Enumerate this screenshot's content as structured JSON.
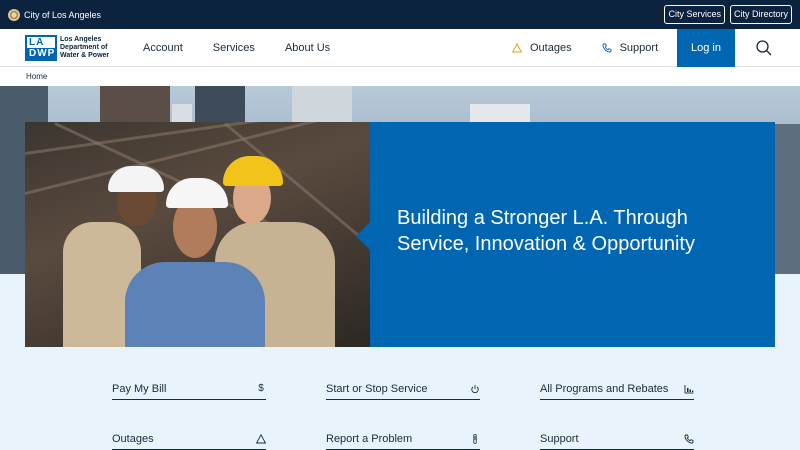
{
  "topbar": {
    "city_label": "City of Los Angeles",
    "city_services": "City Services",
    "city_directory": "City Directory"
  },
  "logo": {
    "mark_top": "LA",
    "mark_bottom": "DWP",
    "text": "Los Angeles Department of Water & Power"
  },
  "nav": {
    "items": [
      "Account",
      "Services",
      "About Us"
    ],
    "outages": "Outages",
    "support": "Support",
    "login": "Log in"
  },
  "breadcrumb": {
    "home": "Home"
  },
  "hero": {
    "title": "Building a Stronger L.A. Through Service, Innovation & Opportunity"
  },
  "quick_links": [
    {
      "label": "Pay My Bill",
      "icon": "dollar-icon"
    },
    {
      "label": "Start or Stop Service",
      "icon": "power-icon"
    },
    {
      "label": "All Programs and Rebates",
      "icon": "bar-chart-icon"
    },
    {
      "label": "Outages",
      "icon": "warning-icon"
    },
    {
      "label": "Report a Problem",
      "icon": "exclamation-icon"
    },
    {
      "label": "Support",
      "icon": "phone-icon"
    }
  ],
  "colors": {
    "brand_blue": "#0066b2",
    "navy": "#0c2340",
    "light_bg": "#e9f3fb"
  }
}
